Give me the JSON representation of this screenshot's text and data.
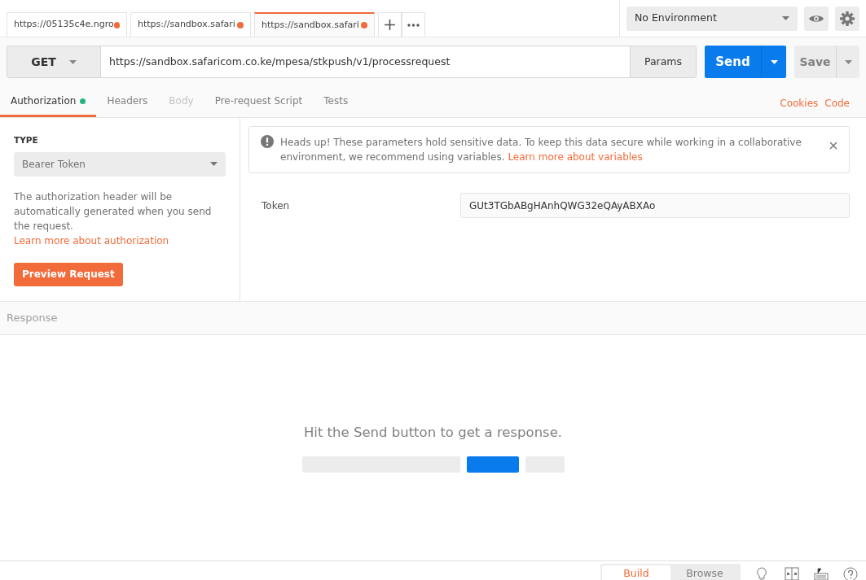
{
  "tabs": [
    {
      "label": "https://05135c4e.ngro",
      "selected": false,
      "unsaved": true
    },
    {
      "label": "https://sandbox.safari",
      "selected": false,
      "unsaved": true
    },
    {
      "label": "https://sandbox.safari",
      "selected": true,
      "unsaved": true
    }
  ],
  "environment": {
    "value": "No Environment"
  },
  "request": {
    "method": "GET",
    "url": "https://sandbox.safaricom.co.ke/mpesa/stkpush/v1/processrequest",
    "params": "Params",
    "send": "Send",
    "save": "Save"
  },
  "request_tabs": [
    {
      "label": "Authorization",
      "selected": true,
      "disabled": false,
      "indicator": true
    },
    {
      "label": "Headers",
      "selected": false,
      "disabled": false,
      "indicator": false
    },
    {
      "label": "Body",
      "selected": false,
      "disabled": true,
      "indicator": false
    },
    {
      "label": "Pre-request Script",
      "selected": false,
      "disabled": false,
      "indicator": false
    },
    {
      "label": "Tests",
      "selected": false,
      "disabled": false,
      "indicator": false
    }
  ],
  "links": [
    "Cookies",
    "Code"
  ],
  "auth": {
    "type_label": "TYPE",
    "type": "Bearer Token",
    "description": "The authorization header will be automatically generated when you send the request.",
    "learn_more": "Learn more about authorization",
    "preview": "Preview Request"
  },
  "alert": {
    "text": "Heads up! These parameters hold sensitive data. To keep this data secure while working in a collaborative environment, we recommend using variables.",
    "link": "Learn more about variables"
  },
  "token": {
    "label": "Token",
    "value": "GUt3TGbABgHAnhQWG32eQAyABXAo"
  },
  "response": {
    "title": "Response",
    "empty_message": "Hit the Send button to get a response."
  },
  "status_bar": {
    "modes": [
      {
        "label": "Build",
        "selected": true
      },
      {
        "label": "Browse",
        "selected": false
      }
    ]
  }
}
